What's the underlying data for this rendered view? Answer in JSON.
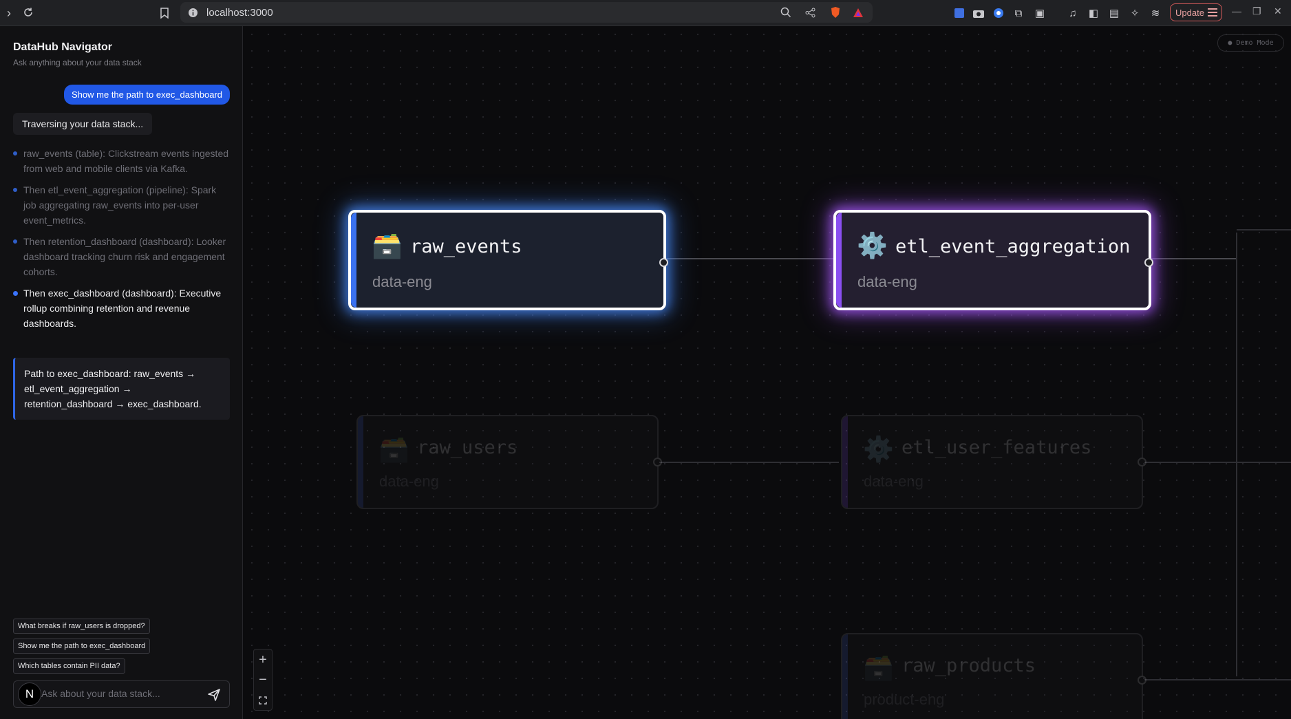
{
  "browser": {
    "url": "localhost:3000",
    "update_label": "Update"
  },
  "sidebar": {
    "title": "DataHub Navigator",
    "subtitle": "Ask anything about your data stack",
    "user_message": "Show me the path to exec_dashboard",
    "status_message": "Traversing your data stack...",
    "steps": [
      {
        "text": "raw_events (table): Clickstream events ingested from web and mobile clients via Kafka.",
        "active": false
      },
      {
        "text": "Then etl_event_aggregation (pipeline): Spark job aggregating raw_events into per-user event_metrics.",
        "active": false
      },
      {
        "text": "Then retention_dashboard (dashboard): Looker dashboard tracking churn risk and engagement cohorts.",
        "active": false
      },
      {
        "text": "Then exec_dashboard (dashboard): Executive rollup combining retention and revenue dashboards.",
        "active": true
      }
    ],
    "path_summary": "Path to exec_dashboard: raw_events → etl_event_aggregation → retention_dashboard → exec_dashboard.",
    "suggestions": [
      "What breaks if raw_users is dropped?",
      "Show me the path to exec_dashboard",
      "Which tables contain PII data?"
    ],
    "input_placeholder": "Ask about your data stack...",
    "avatar_letter": "N"
  },
  "canvas": {
    "demo_badge": "● Demo Mode",
    "nodes": [
      {
        "name": "raw_events",
        "team": "data-eng",
        "icon": "🗃️",
        "kind": "table",
        "state": "highlighted"
      },
      {
        "name": "etl_event_aggregation",
        "team": "data-eng",
        "icon": "⚙️",
        "kind": "pipeline",
        "state": "highlighted"
      },
      {
        "name": "raw_users",
        "team": "data-eng",
        "icon": "🗃️",
        "kind": "table",
        "state": "dimmed"
      },
      {
        "name": "etl_user_features",
        "team": "data-eng",
        "icon": "⚙️",
        "kind": "pipeline",
        "state": "dimmed"
      },
      {
        "name": "raw_products",
        "team": "product-eng",
        "icon": "🗃️",
        "kind": "table",
        "state": "dimmed"
      }
    ],
    "zoom": {
      "in": "+",
      "out": "−"
    }
  }
}
